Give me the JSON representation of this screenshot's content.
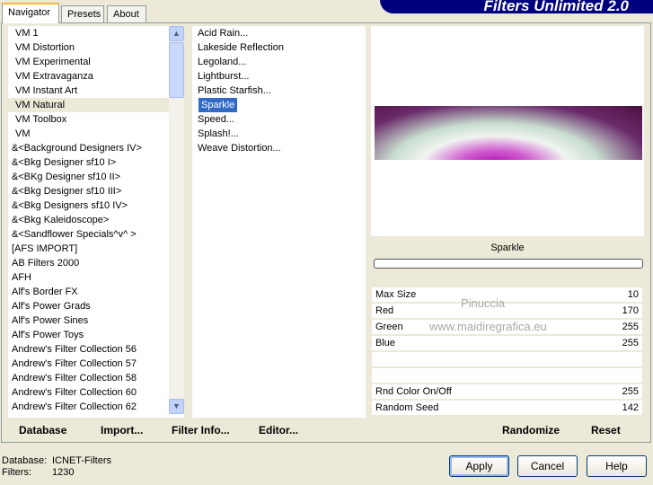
{
  "title": "Filters Unlimited 2.0",
  "tabs": [
    "Navigator",
    "Presets",
    "About"
  ],
  "categories": [
    "VM 1",
    "VM Distortion",
    "VM Experimental",
    "VM Extravaganza",
    "VM Instant Art",
    "VM Natural",
    "VM Toolbox",
    "VM",
    "&<Background Designers IV>",
    "&<Bkg Designer sf10 I>",
    "&<BKg Designer sf10 II>",
    "&<Bkg Designer sf10 III>",
    "&<Bkg Designers sf10 IV>",
    "&<Bkg Kaleidoscope>",
    "&<Sandflower Specials^v^ >",
    "[AFS IMPORT]",
    "AB Filters 2000",
    "AFH",
    "Alf's Border FX",
    "Alf's Power Grads",
    "Alf's Power Sines",
    "Alf's Power Toys",
    "Andrew's Filter Collection 56",
    "Andrew's Filter Collection 57",
    "Andrew's Filter Collection 58",
    "Andrew's Filter Collection 60",
    "Andrew's Filter Collection 62"
  ],
  "filters": [
    "Acid Rain...",
    "Lakeside Reflection",
    "Legoland...",
    "Lightburst...",
    "Plastic Starfish...",
    "Sparkle",
    "Speed...",
    "Splash!...",
    "Weave Distortion..."
  ],
  "selected_filter": "Sparkle",
  "params": [
    {
      "label": "Max Size",
      "value": "10"
    },
    {
      "label": "Red",
      "value": "170"
    },
    {
      "label": "Green",
      "value": "255"
    },
    {
      "label": "Blue",
      "value": "255"
    },
    {
      "label": "",
      "value": ""
    },
    {
      "label": "",
      "value": ""
    },
    {
      "label": "Rnd Color On/Off",
      "value": "255"
    },
    {
      "label": "Random Seed",
      "value": "142"
    }
  ],
  "watermark": [
    "Pinuccia",
    "www.maidiregrafica.eu"
  ],
  "bottom": {
    "database": "Database",
    "import": "Import...",
    "filter_info": "Filter Info...",
    "editor": "Editor...",
    "randomize": "Randomize",
    "reset": "Reset"
  },
  "status": {
    "db_label": "Database:",
    "db_value": "ICNET-Filters",
    "filters_label": "Filters:",
    "filters_value": "1230"
  },
  "buttons": {
    "apply": "Apply",
    "cancel": "Cancel",
    "help": "Help"
  }
}
